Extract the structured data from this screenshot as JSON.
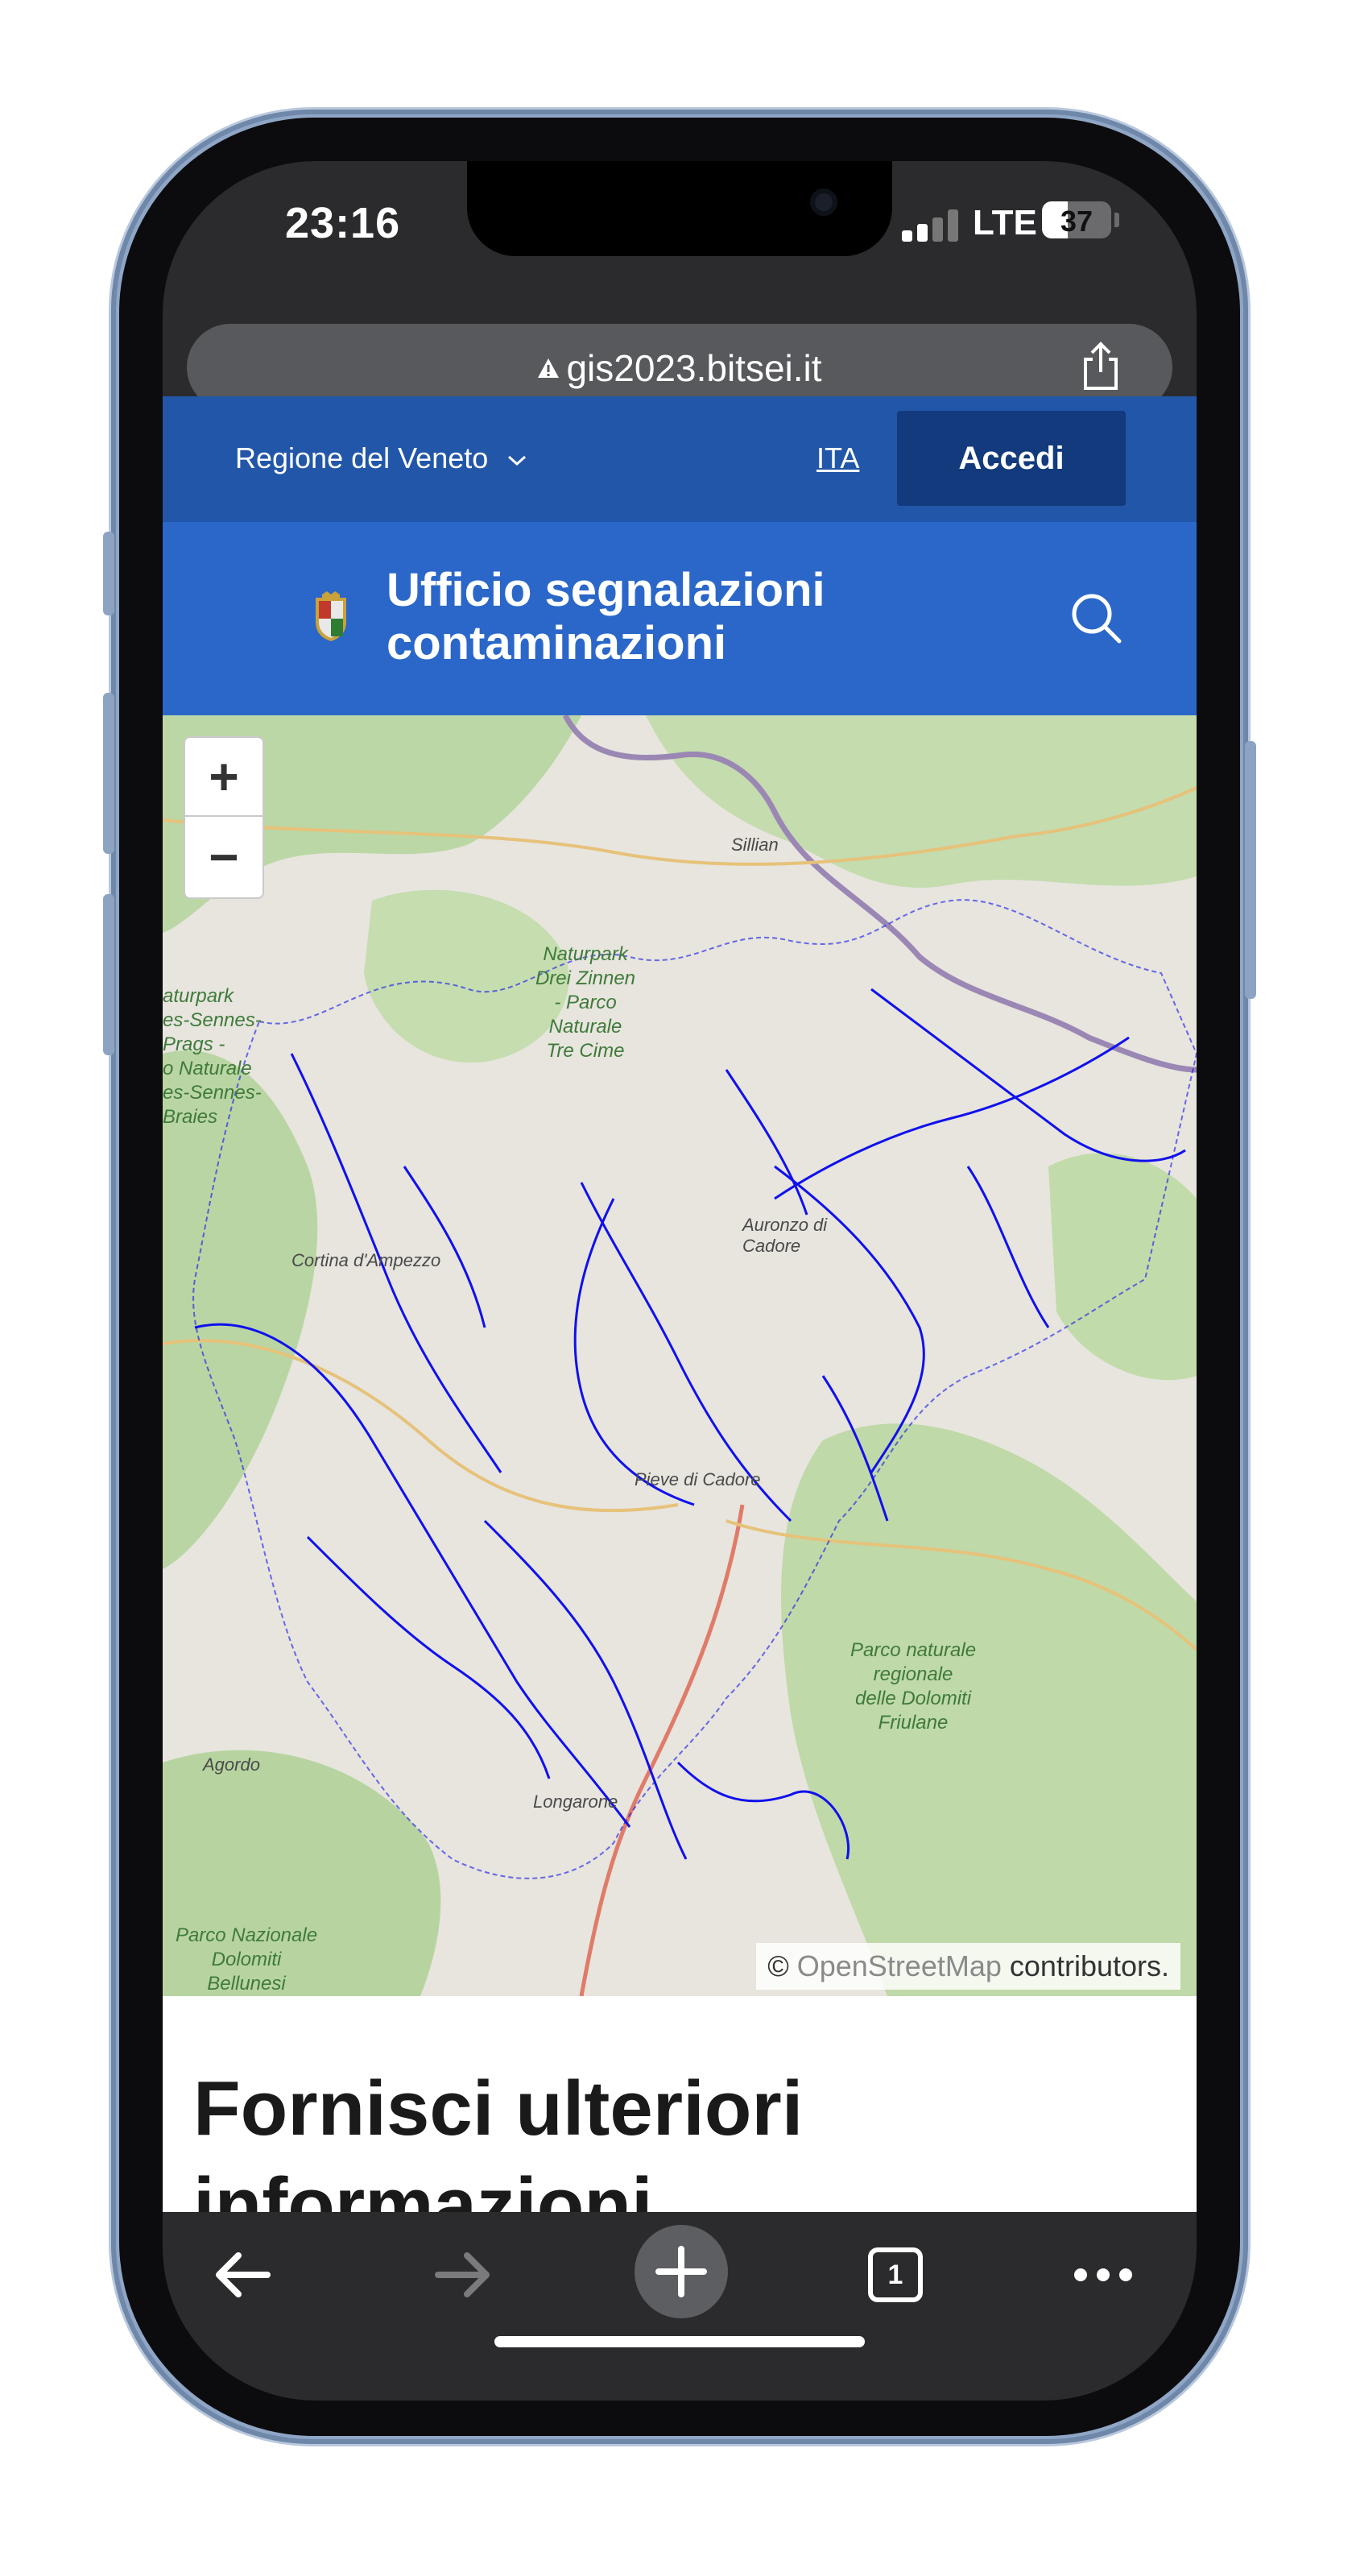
{
  "status_bar": {
    "time": "23:16",
    "network": "LTE",
    "battery": "37"
  },
  "browser": {
    "url": "gis2023.bitsei.it",
    "security_icon": "warning-triangle-icon",
    "share_icon": "share-icon"
  },
  "topbar": {
    "region": "Regione del Veneto",
    "language": "ITA",
    "login_label": "Accedi"
  },
  "header": {
    "title": "Ufficio segnalazioni contaminazioni",
    "search_icon": "search-icon"
  },
  "map": {
    "zoom_in": "+",
    "zoom_out": "−",
    "attribution_symbol": "©",
    "attribution_osm": "OpenStreetMap",
    "attribution_rest": "contributors.",
    "places": {
      "sillian": "Sillian",
      "naturpark_drei_zinnen": "Naturpark\nDrei Zinnen\n- Parco\nNaturale\nTre Cime",
      "naturpark_fanes": "aturpark\nes-Sennes-\nPrags -\no Naturale\nes-Sennes-\nBraies",
      "cortina": "Cortina d'Ampezzo",
      "auronzo": "Auronzo di\nCadore",
      "pieve": "Pieve di Cadore",
      "parco_dolomiti_friulane": "Parco naturale\nregionale\ndelle Dolomiti\nFriulane",
      "agordo": "Agordo",
      "longarone": "Longarone",
      "parco_dolomiti_bellunesi": "Parco Nazionale\nDolomiti\nBellunesi"
    },
    "overlay_color": "#1010ee"
  },
  "content": {
    "heading": "Fornisci ulteriori informazioni"
  },
  "toolbar": {
    "tabs_count": "1",
    "back_icon": "back-arrow-icon",
    "forward_icon": "forward-arrow-icon",
    "new_tab_icon": "plus-icon",
    "more_icon": "more-dots-icon"
  },
  "colors": {
    "topbar": "#2256a8",
    "header": "#2a67c9",
    "login_button": "#123a7c",
    "chrome": "#2b2b2d"
  }
}
